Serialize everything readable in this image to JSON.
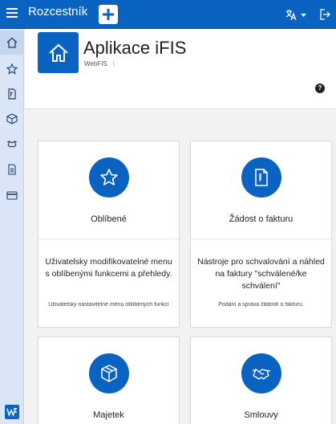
{
  "header": {
    "app_title": "Rozcestník"
  },
  "page": {
    "title": "Aplikace iFIS",
    "breadcrumb": "WebFIS",
    "breadcrumb_sep": "\\",
    "help": "?"
  },
  "sidebar": {
    "items": [
      "home-icon",
      "star-icon",
      "invoice-icon",
      "box-icon",
      "handshake-icon",
      "document-icon",
      "card-icon"
    ]
  },
  "cards": [
    {
      "icon": "star-icon",
      "title": "Oblíbené",
      "description": "Uživatelsky modifikovatelné menu s oblíbenými funkcemi a přehledy.",
      "subtitle": "Uživatelsky nastavitelné menu oblíbených funkcí"
    },
    {
      "icon": "invoice-icon",
      "title": "Žádost o fakturu",
      "description": "Nástroje pro schvalování a náhled na faktury \"schválené/ke schválení\"",
      "subtitle": "Podání a správa žádostí o fakturu."
    },
    {
      "icon": "box-icon",
      "title": "Majetek"
    },
    {
      "icon": "handshake-icon",
      "title": "Smlouvy"
    }
  ],
  "colors": {
    "primary": "#0a63c0",
    "sidebar": "#dae6f5",
    "background": "#f2f2f2"
  }
}
